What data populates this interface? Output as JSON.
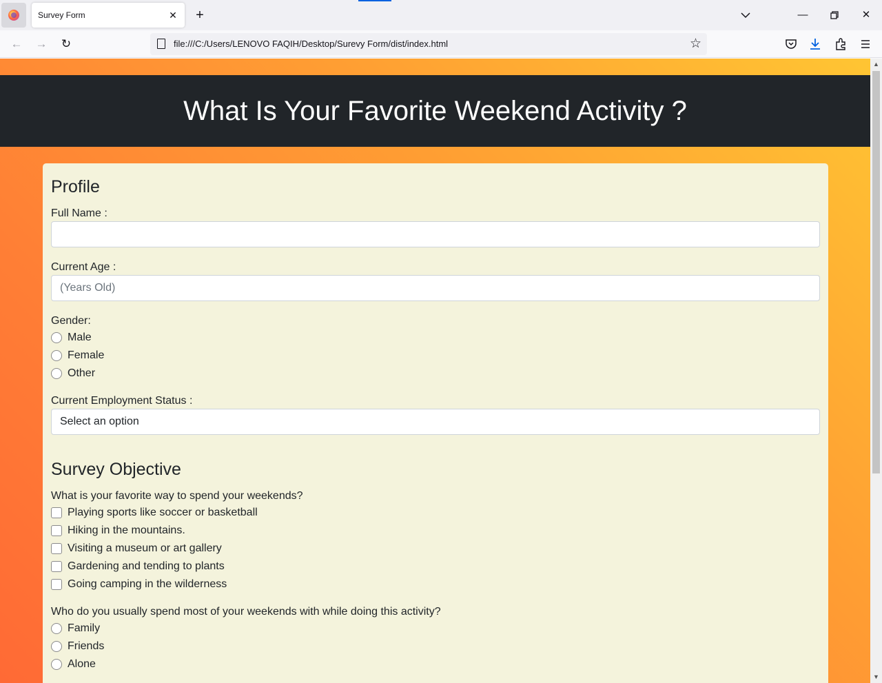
{
  "browser": {
    "tab_title": "Survey Form",
    "url": "file:///C:/Users/LENOVO FAQIH/Desktop/Surevy Form/dist/index.html",
    "icons": [
      "firefox-icon",
      "close-icon",
      "plus-icon",
      "chevron-down-icon",
      "minimize-icon",
      "restore-icon",
      "window-close-icon",
      "back-icon",
      "forward-icon",
      "reload-icon",
      "page-icon",
      "star-icon",
      "pocket-icon",
      "download-icon",
      "extensions-icon",
      "menu-icon"
    ]
  },
  "page": {
    "heading": "What Is Your Favorite Weekend Activity ?",
    "profile": {
      "title": "Profile",
      "full_name_label": "Full Name :",
      "full_name_value": "",
      "age_label": "Current Age :",
      "age_placeholder": "(Years Old)",
      "gender_label": "Gender:",
      "gender_options": [
        "Male",
        "Female",
        "Other"
      ],
      "employment_label": "Current Employment Status :",
      "employment_selected": "Select an option"
    },
    "objective": {
      "title": "Survey Objective",
      "question1": "What is your favorite way to spend your weekends?",
      "activities": [
        "Playing sports like soccer or basketball",
        "Hiking in the mountains.",
        "Visiting a museum or art gallery",
        "Gardening and tending to plants",
        "Going camping in the wilderness"
      ],
      "question2": "Who do you usually spend most of your weekends with while doing this activity?",
      "companions": [
        "Family",
        "Friends",
        "Alone"
      ]
    }
  }
}
